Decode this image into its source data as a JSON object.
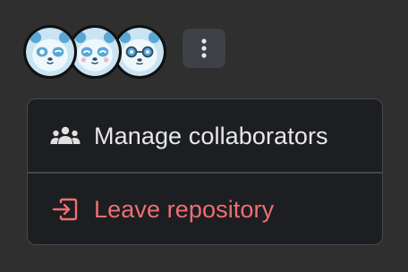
{
  "collaborators": {
    "avatars": [
      {
        "name": "panda-avatar-winking",
        "bg": "#c9e4f3",
        "accent": "#5aa7d6"
      },
      {
        "name": "panda-avatar-happy",
        "bg": "#c9e4f3",
        "accent": "#5aa7d6"
      },
      {
        "name": "panda-avatar-glasses",
        "bg": "#c9e4f3",
        "accent": "#5aa7d6"
      }
    ]
  },
  "more_button": {
    "icon": "kebab-menu-icon"
  },
  "menu": {
    "items": [
      {
        "label": "Manage collaborators",
        "icon": "people-icon",
        "color": "#e8e8e8"
      },
      {
        "label": "Leave repository",
        "icon": "sign-out-icon",
        "color": "#ee6e73"
      }
    ]
  },
  "colors": {
    "background": "#2f2f2f",
    "menu_background": "#1c1e21",
    "menu_border": "#45484d",
    "button_background": "#3d4046",
    "danger": "#ee6e73"
  }
}
